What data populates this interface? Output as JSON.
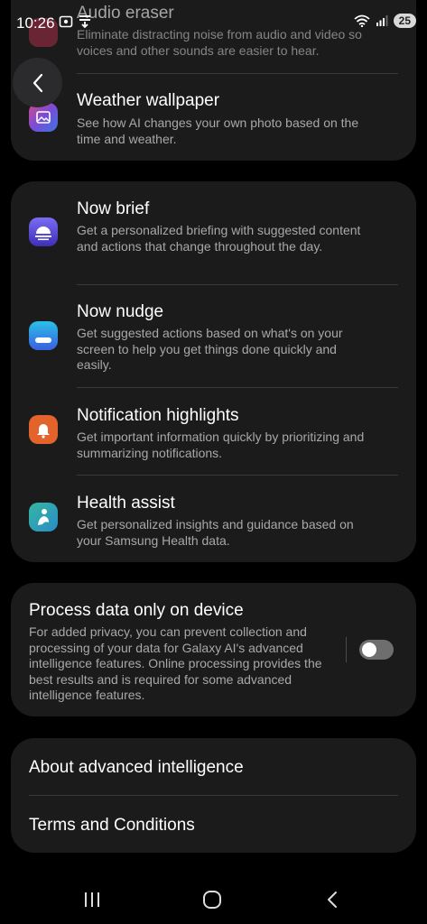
{
  "status": {
    "time": "10:26",
    "battery": "25"
  },
  "card1": {
    "partial_title": "Audio eraser",
    "partial_desc": "Eliminate distracting noise from audio and video so voices and other sounds are easier to hear.",
    "weather_title": "Weather wallpaper",
    "weather_desc": "See how AI changes your own photo based on the time and weather."
  },
  "card2": {
    "items": [
      {
        "title": "Now brief",
        "desc": "Get a personalized briefing with suggested content and actions that change throughout the day."
      },
      {
        "title": "Now nudge",
        "desc": "Get suggested actions based on what's on your screen to help you get things done quickly and easily."
      },
      {
        "title": "Notification highlights",
        "desc": "Get important information quickly by prioritizing and summarizing notifications."
      },
      {
        "title": "Health assist",
        "desc": "Get personalized insights and guidance based on your Samsung Health data."
      }
    ]
  },
  "card3": {
    "title": "Process data only on device",
    "desc": "For added privacy, you can prevent collection and processing of your data for Galaxy AI's advanced intelligence features. Online processing provides the best results and is required for some advanced intelligence features.",
    "toggle_on": false
  },
  "card4": {
    "about": "About advanced intelligence",
    "terms": "Terms and Conditions"
  },
  "icons": {
    "back": "back-arrow-icon",
    "audio": "audio-eraser-icon",
    "weather": "weather-wallpaper-icon",
    "now_brief": "now-brief-icon",
    "now_nudge": "now-nudge-icon",
    "notification": "notification-highlights-icon",
    "health": "health-assist-icon"
  },
  "colors": {
    "background": "#000000",
    "card": "#1b1b1c",
    "secondary_text": "#a8a8a8",
    "now_brief": "#5b4bd6",
    "now_nudge": "#3f8ce8",
    "notification": "#e2632b",
    "health": "#2fa59a"
  }
}
